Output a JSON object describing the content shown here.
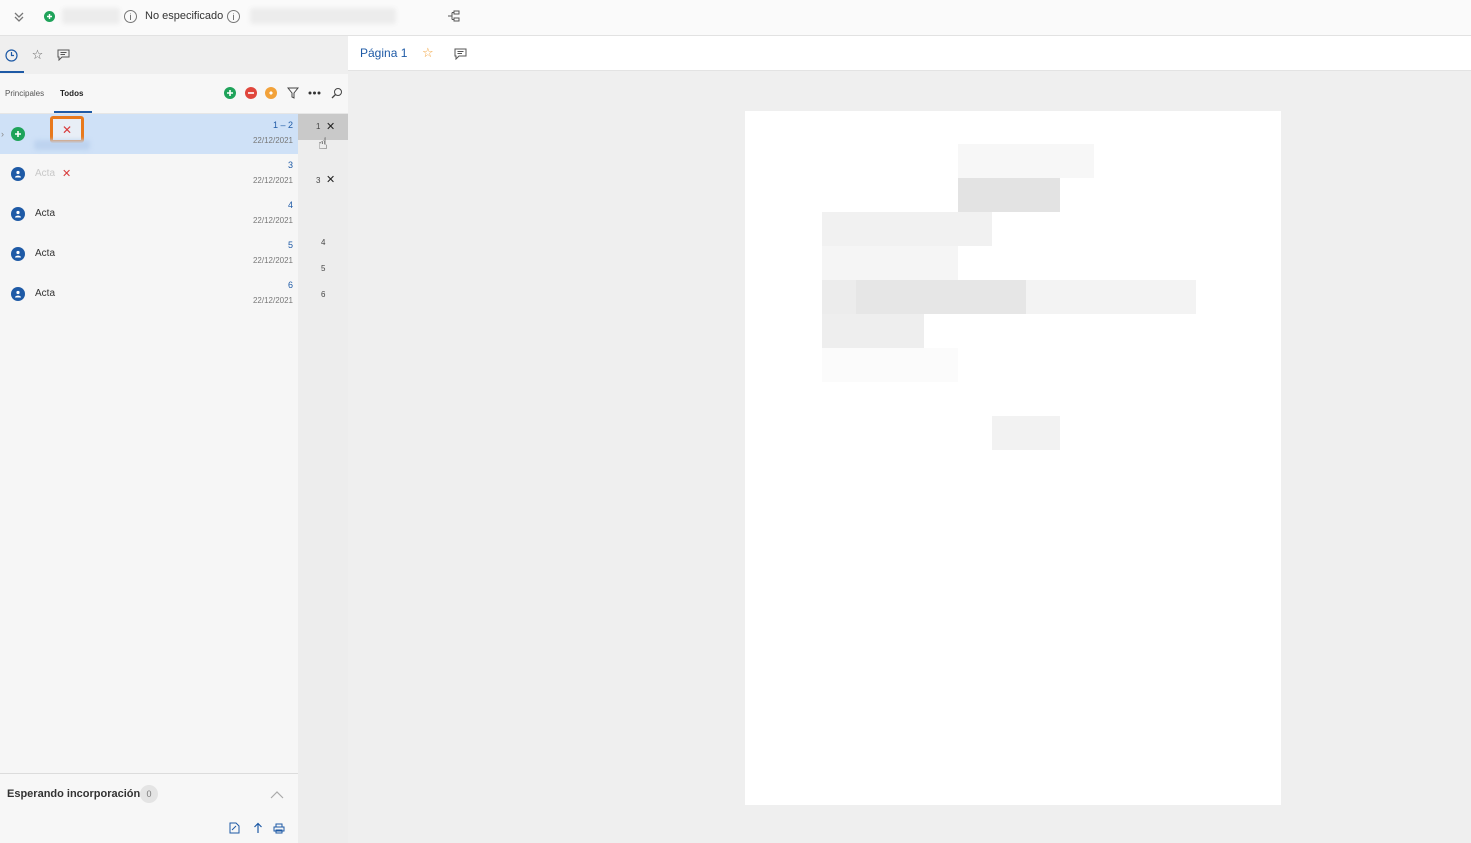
{
  "topbar": {
    "status": "No especificado"
  },
  "left_tabs": {
    "active": "history"
  },
  "panel": {
    "tabs": [
      "Principales",
      "Todos"
    ],
    "active_tab": "Todos"
  },
  "rows": [
    {
      "label": "",
      "num": "1 – 2",
      "date": "22/12/2021",
      "selected": true
    },
    {
      "label": "Acta",
      "num": "3",
      "date": "22/12/2021",
      "selected": false
    },
    {
      "label": "Acta",
      "num": "4",
      "date": "22/12/2021",
      "selected": false
    },
    {
      "label": "Acta",
      "num": "5",
      "date": "22/12/2021",
      "selected": false
    },
    {
      "label": "Acta",
      "num": "6",
      "date": "22/12/2021",
      "selected": false
    }
  ],
  "pages": [
    "1",
    "3",
    "4",
    "5",
    "6"
  ],
  "footer": {
    "waiting_label": "Esperando incorporación",
    "waiting_count": "0"
  },
  "main": {
    "page_label": "Página 1"
  },
  "colors": {
    "accent": "#1e5aa6",
    "green": "#1fa35a",
    "red": "#e0463c",
    "orange": "#f2a23a",
    "selection": "#cfe1f7",
    "highlight": "#e8791c"
  }
}
